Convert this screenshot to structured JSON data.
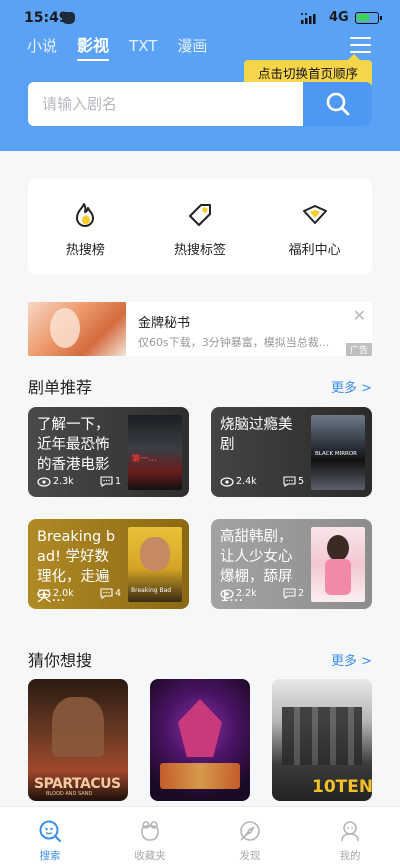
{
  "status_bar": {
    "time": "15:49",
    "network": "4G"
  },
  "tabs": [
    {
      "label": "小说",
      "active": false
    },
    {
      "label": "影视",
      "active": true
    },
    {
      "label": "TXT",
      "active": false
    },
    {
      "label": "漫画",
      "active": false
    }
  ],
  "tooltip": "点击切换首页顺序",
  "search": {
    "placeholder": "请输入剧名"
  },
  "shortcuts": [
    {
      "label": "热搜榜",
      "icon": "flame-icon"
    },
    {
      "label": "热搜标签",
      "icon": "tag-icon"
    },
    {
      "label": "福利中心",
      "icon": "gift-icon"
    }
  ],
  "ad": {
    "title": "金牌秘书",
    "description": "仅60s下载，3分钟暴富，模拟当总裁...",
    "tag": "广告"
  },
  "recommend": {
    "title": "剧单推荐",
    "more": "更多 >",
    "items": [
      {
        "title": "了解一下，近年最恐怖的香港电影",
        "views": "2.3k",
        "comments": "1",
        "bg": "#3d3d3d"
      },
      {
        "title": "烧脑过瘾美剧",
        "views": "2.4k",
        "comments": "5",
        "bg": "#3a3a3a"
      },
      {
        "title": "Breaking bad! 学好数理化，走遍天...",
        "views": "2.0k",
        "comments": "4",
        "bg": "#a98320"
      },
      {
        "title": "高甜韩剧，让人少女心爆棚，舔屏1...",
        "views": "2.2k",
        "comments": "2",
        "bg": "#9a9a9a"
      }
    ]
  },
  "guess": {
    "title": "猜你想搜",
    "more": "更多 >",
    "items": [
      {
        "poster_text": "SPARTACUS"
      },
      {
        "poster_text": ""
      },
      {
        "poster_text": "10TEN"
      }
    ]
  },
  "posters": {
    "horror": "第一...",
    "black_mirror": "BLACK MIRROR",
    "breaking_bad": "Breaking Bad",
    "spartacus_sub": "BLOOD AND SAND"
  },
  "bottom_nav": [
    {
      "label": "搜索",
      "icon": "search-face-icon",
      "active": true
    },
    {
      "label": "收藏夹",
      "icon": "favorites-icon",
      "active": false
    },
    {
      "label": "发现",
      "icon": "discover-icon",
      "active": false
    },
    {
      "label": "我的",
      "icon": "profile-icon",
      "active": false
    }
  ],
  "colors": {
    "header": "#5aa2f5",
    "search_button": "#4e97f2",
    "accent": "#3b8ff0",
    "tooltip": "#f6d54a",
    "icon_yellow": "#f6cd2a"
  }
}
